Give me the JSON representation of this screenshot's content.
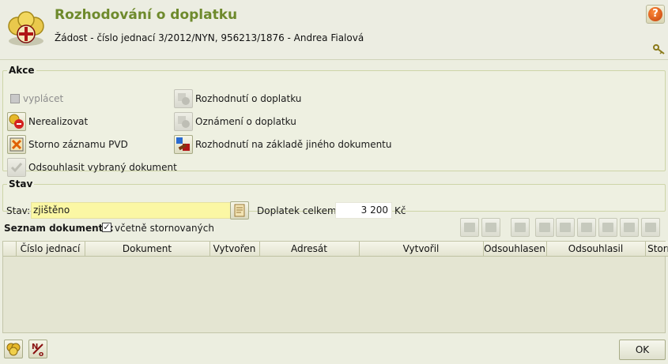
{
  "header": {
    "title": "Rozhodování o doplatku",
    "subtitle": "Žádost - číslo jednací 3/2012/NYN, 956213/1876 - Andrea Fialová",
    "help_label": "?"
  },
  "akce": {
    "legend": "Akce",
    "vyplacet": "vyplácet",
    "nerealizovat": "Nerealizovat",
    "storno": "Storno záznamu PVD",
    "odsouhlasit": "Odsouhlasit vybraný dokument",
    "rozhodnuti": "Rozhodnutí o doplatku",
    "oznameni": "Oznámení o doplatku",
    "rozhodnuti_jine": "Rozhodnutí na základě jiného dokumentu"
  },
  "stav": {
    "legend": "Stav",
    "label": "Stav:",
    "value": "zjištěno",
    "doplatek_label": "Doplatek celkem:",
    "doplatek_value": "3 200",
    "doplatek_unit": "Kč"
  },
  "seznam": {
    "label": "Seznam dokumentů:",
    "include_label": "včetně stornovaných",
    "include_checked": "✓",
    "columns": [
      "",
      "Číslo jednací",
      "Dokument",
      "Vytvořen",
      "Adresát",
      "Vytvořil",
      "Odsouhlasen",
      "Odsouhlasil",
      "Storno"
    ]
  },
  "footer": {
    "ok_label": "OK"
  },
  "colors": {
    "title_green": "#6e8a2c",
    "highlight_yellow": "#fbf7a4",
    "panel_bg": "#eef0e1"
  }
}
